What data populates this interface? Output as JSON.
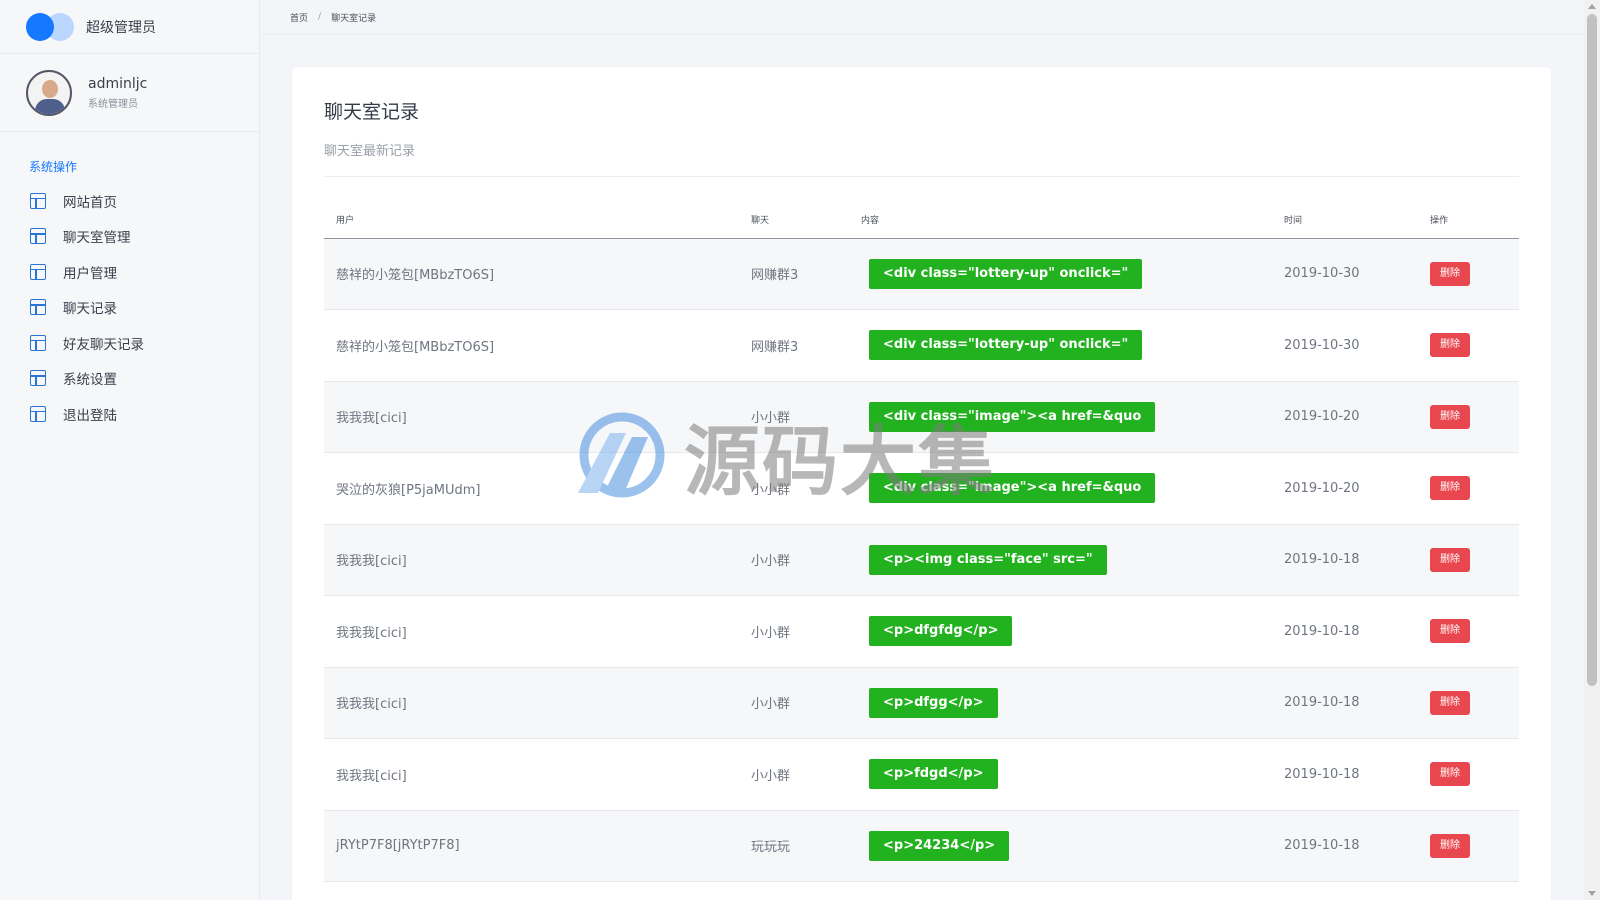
{
  "brand": {
    "title": "超级管理员"
  },
  "user": {
    "name": "adminljc",
    "role": "系统管理员"
  },
  "sidebar": {
    "section_title": "系统操作",
    "items": [
      {
        "label": "网站首页",
        "icon": "layout-icon"
      },
      {
        "label": "聊天室管理",
        "icon": "layout-icon"
      },
      {
        "label": "用户管理",
        "icon": "layout-icon"
      },
      {
        "label": "聊天记录",
        "icon": "layout-icon"
      },
      {
        "label": "好友聊天记录",
        "icon": "layout-icon"
      },
      {
        "label": "系统设置",
        "icon": "layout-icon"
      },
      {
        "label": "退出登陆",
        "icon": "layout-icon"
      }
    ]
  },
  "breadcrumb": {
    "home": "首页",
    "separator": "/",
    "current": "聊天室记录"
  },
  "page": {
    "title": "聊天室记录",
    "subtitle": "聊天室最新记录"
  },
  "table": {
    "headers": {
      "user": "用户",
      "chat": "聊天",
      "content": "内容",
      "time": "时间",
      "action": "操作"
    },
    "rows": [
      {
        "user": "慈祥的小笼包[MBbzTO6S]",
        "chat": "网赚群3",
        "content": "<div class=\"lottery-up\" onclick=\"",
        "time": "2019-10-30",
        "action": "删除"
      },
      {
        "user": "慈祥的小笼包[MBbzTO6S]",
        "chat": "网赚群3",
        "content": "<div class=\"lottery-up\" onclick=\"",
        "time": "2019-10-30",
        "action": "删除"
      },
      {
        "user": "我我我[cici]",
        "chat": "小小群",
        "content": "<div class=\"image\"><a href=&quo",
        "time": "2019-10-20",
        "action": "删除"
      },
      {
        "user": "哭泣的灰狼[P5jaMUdm]",
        "chat": "小小群",
        "content": "<div class=\"image\"><a href=&quo",
        "time": "2019-10-20",
        "action": "删除"
      },
      {
        "user": "我我我[cici]",
        "chat": "小小群",
        "content": "<p><img class=\"face\" src=\"",
        "time": "2019-10-18",
        "action": "删除"
      },
      {
        "user": "我我我[cici]",
        "chat": "小小群",
        "content": "<p>dfgfdg</p>",
        "time": "2019-10-18",
        "action": "删除"
      },
      {
        "user": "我我我[cici]",
        "chat": "小小群",
        "content": "<p>dfgg</p>",
        "time": "2019-10-18",
        "action": "删除"
      },
      {
        "user": "我我我[cici]",
        "chat": "小小群",
        "content": "<p>fdgd</p>",
        "time": "2019-10-18",
        "action": "删除"
      },
      {
        "user": "jRYtP7F8[jRYtP7F8]",
        "chat": "玩玩玩",
        "content": "<p>24234</p>",
        "time": "2019-10-18",
        "action": "删除"
      }
    ]
  },
  "watermark": {
    "text": "源码大集"
  },
  "colors": {
    "accent": "#1677ff",
    "content_badge": "#22b21f",
    "delete_button": "#e9474f"
  }
}
